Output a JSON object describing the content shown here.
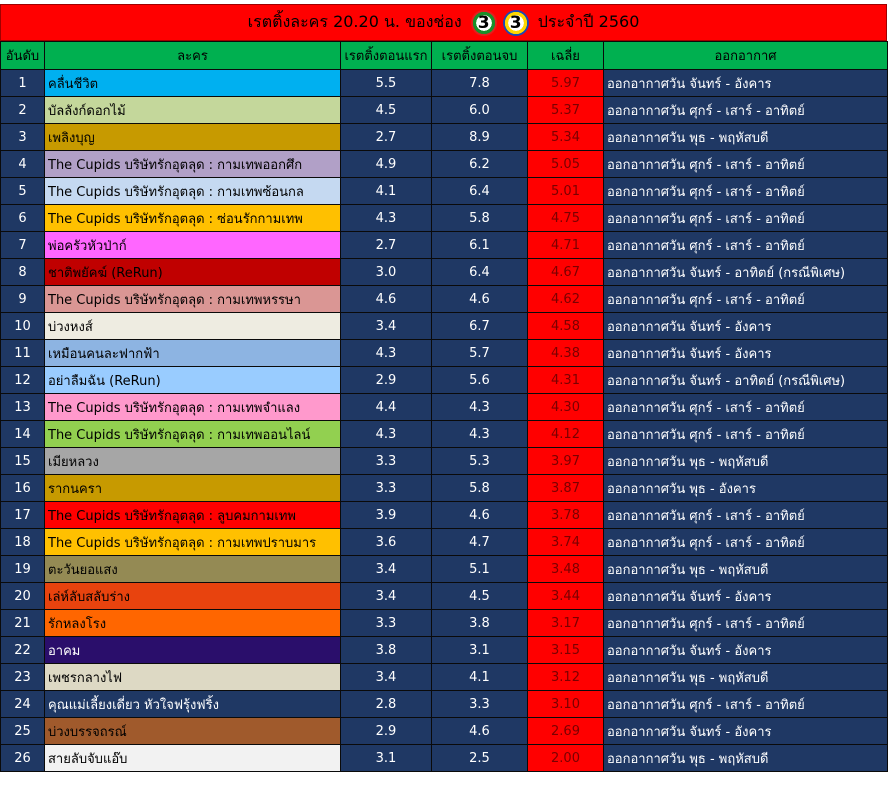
{
  "title": {
    "text": "เรตติ้งละคร 20.20 น. ของช่อง",
    "year": "ประจำปี 2560",
    "logos": [
      "channel-3-logo",
      "channel-3-logo"
    ]
  },
  "headers": {
    "rank": "อันดับ",
    "name": "ละคร",
    "first": "เรตติ้งตอนแรก",
    "last": "เรตติ้งตอนจบ",
    "avg": "เฉลี่ย",
    "air": "ออกอากาศ"
  },
  "colors": {
    "title_bg": "#ff0000",
    "header_bg": "#00b050",
    "body_bg": "#1f3864",
    "avg_bg": "#ff0000"
  },
  "rows": [
    {
      "rank": "1",
      "name": "คลื่นชีวิต",
      "first": "5.5",
      "last": "7.8",
      "avg": "5.97",
      "air": "ออกอากาศวัน จันทร์ - อังคาร",
      "color": "#00b0f0",
      "text": "#000000"
    },
    {
      "rank": "2",
      "name": "บัลลังก์ดอกไม้",
      "first": "4.5",
      "last": "6.0",
      "avg": "5.37",
      "air": "ออกอากาศวัน ศุกร์ - เสาร์ - อาทิตย์",
      "color": "#c4d79b",
      "text": "#000000"
    },
    {
      "rank": "3",
      "name": "เพลิงบุญ",
      "first": "2.7",
      "last": "8.9",
      "avg": "5.34",
      "air": "ออกอากาศวัน พุธ - พฤหัสบดี",
      "color": "#c79a00",
      "text": "#000000"
    },
    {
      "rank": "4",
      "name": "The Cupids บริษัทรักอุตลุด : กามเทพออกศึก",
      "first": "4.9",
      "last": "6.2",
      "avg": "5.05",
      "air": "ออกอากาศวัน ศุกร์ - เสาร์ - อาทิตย์",
      "color": "#b1a0c7",
      "text": "#000000"
    },
    {
      "rank": "5",
      "name": "The Cupids บริษัทรักอุตลุด : กามเทพซ้อนกล",
      "first": "4.1",
      "last": "6.4",
      "avg": "5.01",
      "air": "ออกอากาศวัน ศุกร์ - เสาร์ - อาทิตย์",
      "color": "#c5d9f1",
      "text": "#000000"
    },
    {
      "rank": "6",
      "name": "The Cupids บริษัทรักอุตลุด : ซ่อนรักกามเทพ",
      "first": "4.3",
      "last": "5.8",
      "avg": "4.75",
      "air": "ออกอากาศวัน ศุกร์ - เสาร์ - อาทิตย์",
      "color": "#ffc000",
      "text": "#000000"
    },
    {
      "rank": "7",
      "name": "พ่อครัวหัวป่าก์",
      "first": "2.7",
      "last": "6.1",
      "avg": "4.71",
      "air": "ออกอากาศวัน ศุกร์ - เสาร์ - อาทิตย์",
      "color": "#ff66ff",
      "text": "#000000"
    },
    {
      "rank": "8",
      "name": "ชาติพยัคฆ์ (ReRun)",
      "first": "3.0",
      "last": "6.4",
      "avg": "4.67",
      "air": "ออกอากาศวัน จันทร์ - อาทิตย์ (กรณีพิเศษ)",
      "color": "#c00000",
      "text": "#000000"
    },
    {
      "rank": "9",
      "name": "The Cupids บริษัทรักอุตลุด : กามเทพหรรษา",
      "first": "4.6",
      "last": "4.6",
      "avg": "4.62",
      "air": "ออกอากาศวัน ศุกร์ - เสาร์ - อาทิตย์",
      "color": "#da9694",
      "text": "#000000"
    },
    {
      "rank": "10",
      "name": "บ่วงหงส์",
      "first": "3.4",
      "last": "6.7",
      "avg": "4.58",
      "air": "ออกอากาศวัน จันทร์ - อังคาร",
      "color": "#eeece1",
      "text": "#000000"
    },
    {
      "rank": "11",
      "name": "เหมือนคนละฟากฟ้า",
      "first": "4.3",
      "last": "5.7",
      "avg": "4.38",
      "air": "ออกอากาศวัน จันทร์ - อังคาร",
      "color": "#8db4e2",
      "text": "#000000"
    },
    {
      "rank": "12",
      "name": "อย่าลืมฉัน (ReRun)",
      "first": "2.9",
      "last": "5.6",
      "avg": "4.31",
      "air": "ออกอากาศวัน จันทร์ - อาทิตย์ (กรณีพิเศษ)",
      "color": "#99ccff",
      "text": "#000000"
    },
    {
      "rank": "13",
      "name": "The Cupids บริษัทรักอุตลุด : กามเทพจำแลง",
      "first": "4.4",
      "last": "4.3",
      "avg": "4.30",
      "air": "ออกอากาศวัน ศุกร์ - เสาร์ - อาทิตย์",
      "color": "#ff99cc",
      "text": "#000000"
    },
    {
      "rank": "14",
      "name": "The Cupids บริษัทรักอุตลุด : กามเทพออนไลน์",
      "first": "4.3",
      "last": "4.3",
      "avg": "4.12",
      "air": "ออกอากาศวัน ศุกร์ - เสาร์ - อาทิตย์",
      "color": "#92d050",
      "text": "#000000"
    },
    {
      "rank": "15",
      "name": "เมียหลวง",
      "first": "3.3",
      "last": "5.3",
      "avg": "3.97",
      "air": "ออกอากาศวัน พุธ - พฤหัสบดี",
      "color": "#a6a6a6",
      "text": "#000000"
    },
    {
      "rank": "16",
      "name": "รากนครา",
      "first": "3.3",
      "last": "5.8",
      "avg": "3.87",
      "air": "ออกอากาศวัน พุธ - อังคาร",
      "color": "#c79a00",
      "text": "#000000"
    },
    {
      "rank": "17",
      "name": "The Cupids บริษัทรักอุตลุด : ลูบคมกามเทพ",
      "first": "3.9",
      "last": "4.6",
      "avg": "3.78",
      "air": "ออกอากาศวัน ศุกร์ - เสาร์ - อาทิตย์",
      "color": "#ff0000",
      "text": "#000000"
    },
    {
      "rank": "18",
      "name": "The Cupids บริษัทรักอุตลุด : กามเทพปราบมาร",
      "first": "3.6",
      "last": "4.7",
      "avg": "3.74",
      "air": "ออกอากาศวัน ศุกร์ - เสาร์ - อาทิตย์",
      "color": "#ffc000",
      "text": "#000000"
    },
    {
      "rank": "19",
      "name": "ตะวันยอแสง",
      "first": "3.4",
      "last": "5.1",
      "avg": "3.48",
      "air": "ออกอากาศวัน พุธ - พฤหัสบดี",
      "color": "#948a54",
      "text": "#000000"
    },
    {
      "rank": "20",
      "name": "เล่ห์ลับสลับร่าง",
      "first": "3.4",
      "last": "4.5",
      "avg": "3.44",
      "air": "ออกอากาศวัน จันทร์ - อังคาร",
      "color": "#e8430e",
      "text": "#000000"
    },
    {
      "rank": "21",
      "name": "รักหลงโรง",
      "first": "3.3",
      "last": "3.8",
      "avg": "3.17",
      "air": "ออกอากาศวัน ศุกร์ - เสาร์ - อาทิตย์",
      "color": "#ff6600",
      "text": "#000000"
    },
    {
      "rank": "22",
      "name": "อาคม",
      "first": "3.8",
      "last": "3.1",
      "avg": "3.15",
      "air": "ออกอากาศวัน จันทร์ - อังคาร",
      "color": "#2a0e6b",
      "text": "#ffffff"
    },
    {
      "rank": "23",
      "name": "เพชรกลางไฟ",
      "first": "3.4",
      "last": "4.1",
      "avg": "3.12",
      "air": "ออกอากาศวัน พุธ - พฤหัสบดี",
      "color": "#ddd9c4",
      "text": "#000000"
    },
    {
      "rank": "24",
      "name": "คุณแม่เลี้ยงเดี่ยว หัวใจฟรุ้งฟริ้ง",
      "first": "2.8",
      "last": "3.3",
      "avg": "3.10",
      "air": "ออกอากาศวัน ศุกร์ - เสาร์ - อาทิตย์",
      "color": "#1f3864",
      "text": "#ffffff"
    },
    {
      "rank": "25",
      "name": "บ่วงบรรจถรณ์",
      "first": "2.9",
      "last": "4.6",
      "avg": "2.69",
      "air": "ออกอากาศวัน จันทร์ - อังคาร",
      "color": "#a05a2c",
      "text": "#000000"
    },
    {
      "rank": "26",
      "name": "สายลับจับแอ๊บ",
      "first": "3.1",
      "last": "2.5",
      "avg": "2.00",
      "air": "ออกอากาศวัน พุธ - พฤหัสบดี",
      "color": "#f2f2f2",
      "text": "#000000"
    }
  ]
}
